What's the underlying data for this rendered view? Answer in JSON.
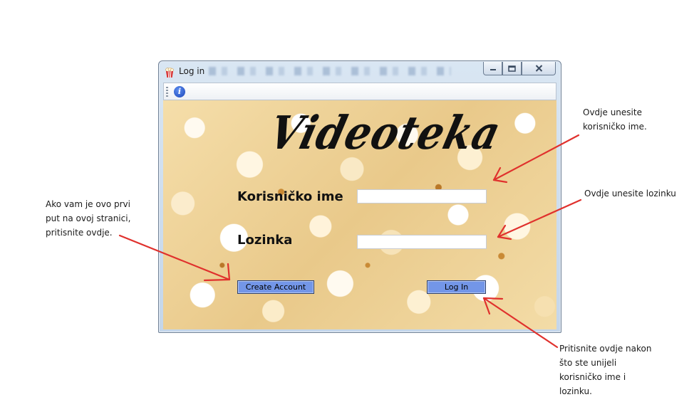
{
  "window": {
    "title": "Log in",
    "controls": {
      "minimize": "minimize",
      "maximize": "maximize",
      "close": "close"
    }
  },
  "toolbar": {
    "info_icon_glyph": "i"
  },
  "form": {
    "logo_text": "Videoteka",
    "username_label": "Korisničko ime",
    "username_value": "",
    "password_label": "Lozinka",
    "password_value": "",
    "create_account_label": "Create Account",
    "login_label": "Log In"
  },
  "annotations": {
    "username_hint": [
      "Ovdje unesite",
      "korisničko ime."
    ],
    "password_hint": [
      "Ovdje unesite lozinku"
    ],
    "create_account_hint": [
      "Ako vam je ovo prvi",
      "put na ovoj stranici,",
      "pritisnite ovdje."
    ],
    "login_hint": [
      "Pritisnite ovdje nakon",
      "što ste unijeli",
      "korisničko ime i",
      "lozinku."
    ]
  },
  "colors": {
    "arrow": "#e0312d",
    "button_fill": "#7396e8",
    "button_border": "#2b3f6f",
    "titlebar": "#c4d6ea"
  },
  "icons": {
    "app": "popcorn-icon",
    "info": "info-icon",
    "minimize": "minimize-icon",
    "maximize": "maximize-icon",
    "close": "close-icon"
  }
}
